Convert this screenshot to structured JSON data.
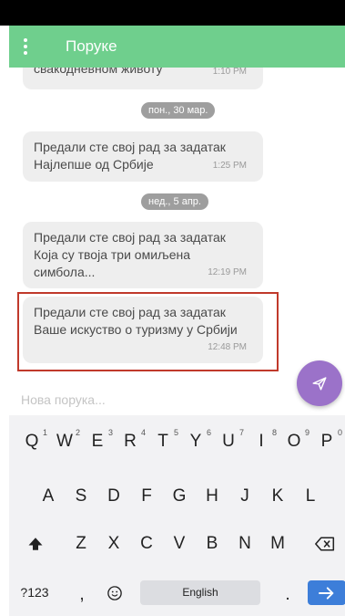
{
  "app": {
    "title": "Поруке"
  },
  "messages": [
    {
      "text": "свакодневном животу",
      "time": "1:10 PM"
    },
    {
      "text": "Предали сте свој рад за задатак Најлепше од Србије",
      "time": "1:25 PM"
    },
    {
      "text": "Предали сте свој рад за задатак Која су твоја три омиљена симбола...",
      "time": "12:19 PM"
    },
    {
      "text": "Предали сте свој рад за задатак Ваше искуство о туризму у Србији",
      "time": "12:48 PM"
    }
  ],
  "dates": [
    "пон., 30 мар.",
    "нед., 5 апр."
  ],
  "composer": {
    "placeholder": "Нова порука..."
  },
  "keyboard": {
    "row1": [
      "Q",
      "W",
      "E",
      "R",
      "T",
      "Y",
      "U",
      "I",
      "O",
      "P"
    ],
    "row1_hints": [
      "1",
      "2",
      "3",
      "4",
      "5",
      "6",
      "7",
      "8",
      "9",
      "0"
    ],
    "row2": [
      "A",
      "S",
      "D",
      "F",
      "G",
      "H",
      "J",
      "K",
      "L"
    ],
    "row3": [
      "Z",
      "X",
      "C",
      "V",
      "B",
      "N",
      "M"
    ],
    "symbols": "?123",
    "comma": ",",
    "period": ".",
    "space": "English"
  },
  "colors": {
    "appbar": "#6fcf8d",
    "fab": "#9b72c9",
    "enter": "#3d7ed9",
    "highlight": "#c0392b"
  }
}
